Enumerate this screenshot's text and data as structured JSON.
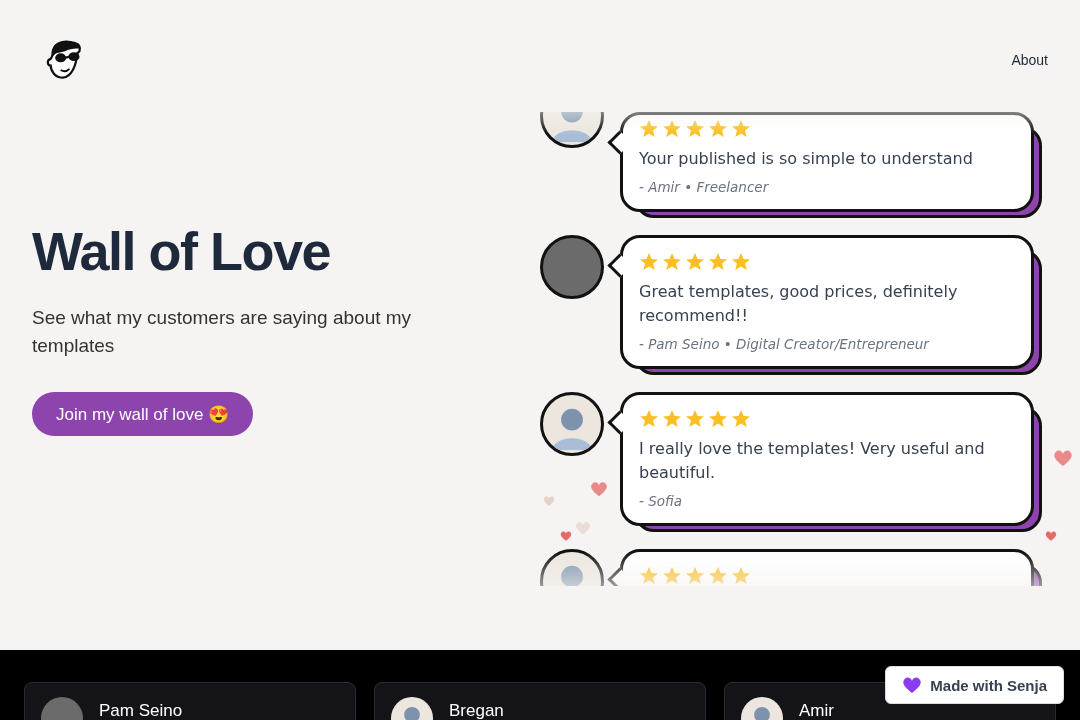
{
  "nav": {
    "links": [
      "About"
    ]
  },
  "hero": {
    "title": "Wall of Love",
    "subtitle": "See what my customers are saying about my templates",
    "cta": "Join my wall of love 😍"
  },
  "wall": [
    {
      "kind": "silhouette",
      "stars": 5,
      "text": "Your published is so simple to understand",
      "author": "- Amir • Freelancer"
    },
    {
      "kind": "photo",
      "stars": 5,
      "text": "Great templates, good prices, definitely recommend!!",
      "author": "- Pam Seino • Digital Creator/Entrepreneur"
    },
    {
      "kind": "silhouette",
      "stars": 5,
      "text": "I really love the templates! Very useful and beautiful.",
      "author": "- Sofia"
    },
    {
      "kind": "silhouette",
      "stars": 5
    }
  ],
  "cards": [
    {
      "kind": "photo",
      "name": "Pam Seino"
    },
    {
      "kind": "silhouette",
      "name": "Bregan"
    },
    {
      "kind": "silhouette",
      "name": "Amir"
    }
  ],
  "badge": {
    "label": "Made with Senja"
  }
}
